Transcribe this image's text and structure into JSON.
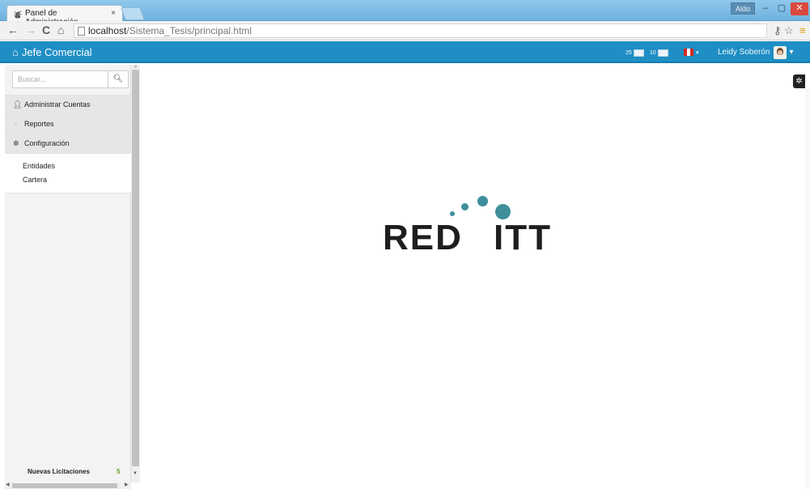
{
  "browser": {
    "tab_title": "Panel de Administración",
    "tab_close": "×",
    "profile_label": "Aldo",
    "address_host": "localhost",
    "address_path": "/Sistema_Tesis/principal.html"
  },
  "header": {
    "brand": "Jefe Comercial",
    "badge_1": "25",
    "badge_2": "10",
    "flag_caret": "▾",
    "user_name": "Leidy Soberón",
    "user_caret": "▾"
  },
  "sidebar": {
    "search_placeholder": "Buscar...",
    "items": [
      {
        "label": "Administrar Cuentas",
        "icon": "user-icon"
      },
      {
        "label": "Reportes",
        "icon": "reports-icon"
      },
      {
        "label": "Configuración",
        "icon": "gear-icon"
      }
    ],
    "submenu": [
      "Entidades",
      "Cartera"
    ],
    "footer_label": "Nuevas Licitaciones",
    "footer_count": "5"
  },
  "main": {
    "logo_word_1": "RED",
    "logo_word_2": "ITT",
    "logo_dot_color": "#3e8e9c"
  },
  "colors": {
    "header_bg": "#1e8ec4",
    "sidebar_bg": "#f3f3f3",
    "counter_green": "#6a9f1f"
  }
}
